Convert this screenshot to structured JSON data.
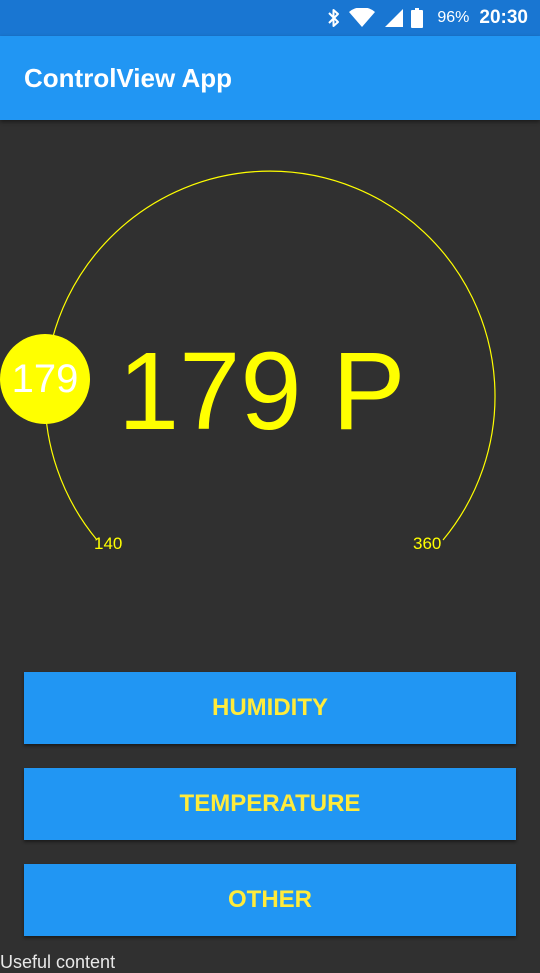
{
  "status_bar": {
    "battery_percent": "96%",
    "time": "20:30",
    "icons": [
      "bluetooth-icon",
      "wifi-icon",
      "signal-icon",
      "battery-icon"
    ]
  },
  "app_bar": {
    "title": "ControlView App"
  },
  "gauge": {
    "display_value": "179 P",
    "knob_value": "179",
    "min_label": "140",
    "max_label": "360",
    "min": 140,
    "max": 360,
    "value": 179,
    "color": "#FFFF00"
  },
  "buttons": {
    "humidity": "HUMIDITY",
    "temperature": "TEMPERATURE",
    "other": "OTHER"
  },
  "footer": {
    "text": "Useful content"
  },
  "colors": {
    "status_bar": "#1976D2",
    "app_bar": "#2196F3",
    "background": "#303030",
    "button": "#2196F3",
    "button_text": "#FFEB3B"
  }
}
